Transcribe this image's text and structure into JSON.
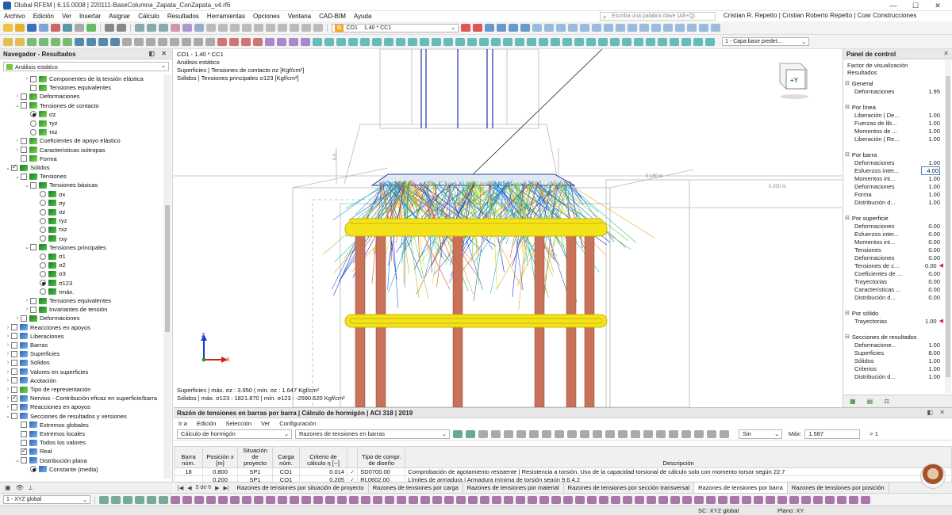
{
  "window": {
    "title": "Dlubal RFEM | 6.15.0008 | 220111-BaseColumna_Zapata_ConZapata_v4.rf6",
    "controls": [
      "—",
      "☐",
      "✕"
    ]
  },
  "menu": {
    "items": [
      "Archivo",
      "Edición",
      "Ver",
      "Insertar",
      "Asignar",
      "Cálculo",
      "Resultados",
      "Herramientas",
      "Opciones",
      "Ventana",
      "CAD-BIM",
      "Ayuda"
    ],
    "search_placeholder": "Escriba una palabra clave (Alt+Q)",
    "user": "Cristian R. Repetto | Cristian Roberto Repetto | Coar Construcciones"
  },
  "toolbar": {
    "lc_badge": "G",
    "load_case": "CO1",
    "load_combo": "1.40 * CC1",
    "layer_select": "1 - Capa base predet..."
  },
  "navigator": {
    "title": "Navegador - Resultados",
    "header_controls": "◧ ✕",
    "analysis_select": "Análisis estático",
    "tree": [
      {
        "label": "Componentes de la tensión elástica",
        "level": 2,
        "exp": "›",
        "cb": "off",
        "icon": "green"
      },
      {
        "label": "Tensiones equivalentes",
        "level": 2,
        "exp": "",
        "cb": "off",
        "icon": "green"
      },
      {
        "label": "Deformaciones",
        "level": 1,
        "exp": "›",
        "cb": "off",
        "icon": "green"
      },
      {
        "label": "Tensiones de contacto",
        "level": 1,
        "exp": "⌄",
        "cb": "off",
        "icon": "green"
      },
      {
        "label": "σz",
        "level": 2,
        "radio": "on",
        "icon": "green"
      },
      {
        "label": "τyz",
        "level": 2,
        "radio": "off",
        "icon": "green"
      },
      {
        "label": "τxz",
        "level": 2,
        "radio": "off",
        "icon": "green"
      },
      {
        "label": "Coeficientes de apoyo elástico",
        "level": 1,
        "exp": "›",
        "cb": "off",
        "icon": "green"
      },
      {
        "label": "Características isótropas",
        "level": 1,
        "exp": "›",
        "cb": "off",
        "icon": "green"
      },
      {
        "label": "Forma",
        "level": 1,
        "exp": "",
        "cb": "off",
        "icon": "green"
      },
      {
        "label": "Sólidos",
        "level": 0,
        "exp": "⌄",
        "cb": "on",
        "icon": "solid"
      },
      {
        "label": "Tensiones",
        "level": 1,
        "exp": "⌄",
        "cb": "off",
        "icon": "solid"
      },
      {
        "label": "Tensiones básicas",
        "level": 2,
        "exp": "⌄",
        "cb": "off",
        "icon": "solid"
      },
      {
        "label": "σx",
        "level": 3,
        "radio": "off",
        "icon": "solid"
      },
      {
        "label": "σy",
        "level": 3,
        "radio": "off",
        "icon": "solid"
      },
      {
        "label": "σz",
        "level": 3,
        "radio": "off",
        "icon": "solid"
      },
      {
        "label": "τyz",
        "level": 3,
        "radio": "off",
        "icon": "solid"
      },
      {
        "label": "τxz",
        "level": 3,
        "radio": "off",
        "icon": "solid"
      },
      {
        "label": "τxy",
        "level": 3,
        "radio": "off",
        "icon": "solid"
      },
      {
        "label": "Tensiones principales",
        "level": 2,
        "exp": "⌄",
        "cb": "off",
        "icon": "solid"
      },
      {
        "label": "σ1",
        "level": 3,
        "radio": "off",
        "icon": "solid"
      },
      {
        "label": "σ2",
        "level": 3,
        "radio": "off",
        "icon": "solid"
      },
      {
        "label": "σ3",
        "level": 3,
        "radio": "off",
        "icon": "solid"
      },
      {
        "label": "σ123",
        "level": 3,
        "radio": "on",
        "icon": "solid"
      },
      {
        "label": "τmáx.",
        "level": 3,
        "radio": "off",
        "icon": "solid"
      },
      {
        "label": "Tensiones equivalentes",
        "level": 2,
        "exp": "›",
        "cb": "off",
        "icon": "solid"
      },
      {
        "label": "Invariantes de tensión",
        "level": 2,
        "exp": "›",
        "cb": "off",
        "icon": "solid"
      },
      {
        "label": "Deformaciones",
        "level": 1,
        "exp": "›",
        "cb": "off",
        "icon": "solid"
      },
      {
        "label": "Reacciones en apoyos",
        "level": 0,
        "exp": "›",
        "cb": "off",
        "icon": "blue"
      },
      {
        "label": "Liberaciones",
        "level": 0,
        "exp": "›",
        "cb": "off",
        "icon": "blue"
      },
      {
        "label": "Barras",
        "level": 0,
        "exp": "›",
        "cb": "off",
        "icon": "blue"
      },
      {
        "label": "Superficies",
        "level": 0,
        "exp": "›",
        "cb": "off",
        "icon": "blue"
      },
      {
        "label": "Sólidos",
        "level": 0,
        "exp": "›",
        "cb": "off",
        "icon": "blue"
      },
      {
        "label": "Valores en superficies",
        "level": 0,
        "exp": "›",
        "cb": "off",
        "icon": "blue"
      },
      {
        "label": "Acotación",
        "level": 0,
        "exp": "›",
        "cb": "off",
        "icon": "blue"
      },
      {
        "label": "Tipo de representación",
        "level": 0,
        "exp": "›",
        "cb": "off",
        "icon": "green"
      },
      {
        "label": "Nervios - Contribución eficaz en superficie/barra",
        "level": 0,
        "exp": "›",
        "cb": "on",
        "icon": "blue"
      },
      {
        "label": "Reacciones en apoyos",
        "level": 0,
        "exp": "›",
        "cb": "off",
        "icon": "blue"
      },
      {
        "label": "Secciones de resultados y versiones",
        "level": 0,
        "exp": "⌄",
        "cb": "off",
        "icon": "blue"
      },
      {
        "label": "Extremos globales",
        "level": 1,
        "exp": "",
        "cb": "off",
        "icon": "blue"
      },
      {
        "label": "Extremos locales",
        "level": 1,
        "exp": "",
        "cb": "off",
        "icon": "blue"
      },
      {
        "label": "Todos los valores",
        "level": 1,
        "exp": "",
        "cb": "off",
        "icon": "blue"
      },
      {
        "label": "Real",
        "level": 1,
        "exp": "",
        "cb": "on",
        "icon": "blue"
      },
      {
        "label": "Distribución plana",
        "level": 1,
        "exp": "⌄",
        "cb": "off",
        "icon": "blue"
      },
      {
        "label": "Constante (media)",
        "level": 2,
        "radio": "on",
        "icon": "blue"
      }
    ],
    "bottom_tabs": [
      "▣",
      "👁",
      "⟂"
    ]
  },
  "viewport": {
    "info_lines": [
      "CO1 - 1.40 * CC1",
      "Análisis estático",
      "Superficies | Tensiones de contacto σz [Kgf/cm²]",
      "Sólidos | Tensiones principales σ123 [Kgf/cm²]"
    ],
    "result_lines": [
      "Superficies | máx. σz : 3.950 | mín. σz : 1.647 Kgf/cm²",
      "Sólidos | máx. σ123 : 1821.870 | mín. σ123 : -2590.520 Kgf/cm²"
    ],
    "axis_labels": [
      "Z",
      "X"
    ],
    "viewcube_label": "+Y",
    "dimension_labels": [
      "0.180 m",
      "0.350 m"
    ]
  },
  "control_panel": {
    "title": "Panel de control",
    "close": "✕",
    "subtitle": "Factor de visualización",
    "subtitle2": "Resultados",
    "groups": [
      {
        "name": "General",
        "rows": [
          {
            "label": "Deformaciones",
            "value": "1.95"
          }
        ]
      },
      {
        "name": "Por línea",
        "rows": [
          {
            "label": "Liberación | De...",
            "value": "1.00"
          },
          {
            "label": "Fuerzas de lib...",
            "value": "1.00"
          },
          {
            "label": "Momentos de ...",
            "value": "1.00"
          },
          {
            "label": "Liberación | Re...",
            "value": "1.00"
          }
        ]
      },
      {
        "name": "Por barra",
        "rows": [
          {
            "label": "Deformaciones",
            "value": "1.00"
          },
          {
            "label": "Esfuerzos inter...",
            "value": "4.00",
            "edit": true
          },
          {
            "label": "Momentos int...",
            "value": "1.00"
          },
          {
            "label": "Deformaciones",
            "value": "1.00"
          },
          {
            "label": "Forma",
            "value": "1.00"
          },
          {
            "label": "Distribución d...",
            "value": "1.00"
          }
        ]
      },
      {
        "name": "Por superficie",
        "rows": [
          {
            "label": "Deformaciones",
            "value": "0.00"
          },
          {
            "label": "Esfuerzos inter...",
            "value": "0.00"
          },
          {
            "label": "Momentos int...",
            "value": "0.00"
          },
          {
            "label": "Tensiones",
            "value": "0.00"
          },
          {
            "label": "Deformaciones",
            "value": "0.00"
          },
          {
            "label": "Tensiones de c...",
            "value": "0.00",
            "flag": true
          },
          {
            "label": "Coeficientes de ...",
            "value": "0.00"
          },
          {
            "label": "Trayectorias",
            "value": "0.00"
          },
          {
            "label": "Características ...",
            "value": "0.00"
          },
          {
            "label": "Distribución d...",
            "value": "0.00"
          }
        ]
      },
      {
        "name": "Por sólido",
        "rows": [
          {
            "label": "Trayectorias",
            "value": "1.00",
            "flag": true
          }
        ]
      },
      {
        "name": "Secciones de resultados",
        "rows": [
          {
            "label": "Deformacione...",
            "value": "1.00"
          },
          {
            "label": "Superficies",
            "value": "8.00"
          },
          {
            "label": "Sólidos",
            "value": "1.00"
          },
          {
            "label": "Criterios",
            "value": "1.00"
          },
          {
            "label": "Distribución d...",
            "value": "1.00"
          }
        ]
      }
    ]
  },
  "table_panel": {
    "title": "Razón de tensiones en barras por barra | Cálculo de hormigón | ACI 318 | 2019",
    "header_controls": "◧ ✕",
    "menu": [
      "Ir a",
      "Edición",
      "Selección",
      "Ver",
      "Configuración"
    ],
    "module_select": "Cálculo de hormigón",
    "table_select": "Razones de tensiones en barras",
    "filter_select": "Sin",
    "max_label": "Máx:",
    "max_value": "1.587",
    "max_cmp": "> 1",
    "columns": [
      "Barra núm.",
      "Posición x [m]",
      "Situación de proyecto",
      "Carga núm.",
      "Criterio de cálculo η [--]",
      "",
      "Tipo de compr. de diseño",
      "Descripción"
    ],
    "rows": [
      {
        "bar": "18",
        "x": "0.800",
        "ds": "SP1",
        "load": "CO1",
        "eta": "0.014",
        "ok": "✓",
        "type": "SD0700.00",
        "desc": "Comprobación de agotamiento resistente | Resistencia a torsión. Uso de la capacidad torsional de cálculo solo con momento torsor según 22.7"
      },
      {
        "bar": "",
        "x": "0.200",
        "ds": "SP1",
        "load": "CO1",
        "eta": "0.205",
        "ok": "✓",
        "type": "RL0602.00",
        "desc": "Límites de armadura | Armadura mínima de torsión según 9.6.4.2"
      }
    ],
    "pager": "5 de 6",
    "tabs": [
      "Razones de tensiones por situación de proyecto",
      "Razones de tensiones por carga",
      "Razones de tensiones por material",
      "Razones de tensiones por sección transversal",
      "Razones de tensiones por barra",
      "Razones de tensiones por posición"
    ]
  },
  "statusbar": {
    "coord_system": "1 - XYZ global",
    "sc": "SC: XYZ global",
    "plane": "Plano: XY"
  }
}
